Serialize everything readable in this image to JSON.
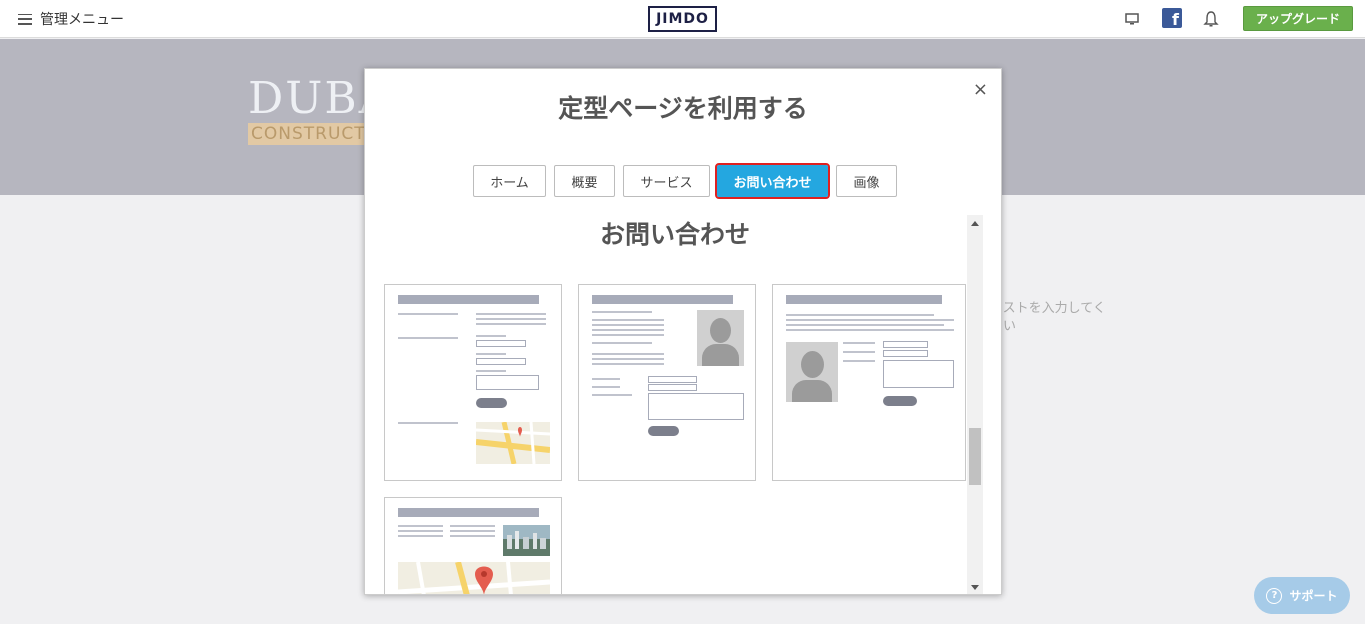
{
  "topbar": {
    "menu_label": "管理メニュー",
    "logo_text": "JIMDO",
    "upgrade_label": "アップグレード",
    "facebook_glyph": "f"
  },
  "background_page": {
    "hero_title": "DUBA",
    "hero_subtitle": "CONSTRUCT",
    "body_text_line1": "キストを入力してく",
    "body_text_line2": "さい"
  },
  "modal": {
    "title": "定型ページを利用する",
    "close_glyph": "×",
    "tabs": [
      {
        "label": "ホーム"
      },
      {
        "label": "概要"
      },
      {
        "label": "サービス"
      },
      {
        "label": "お問い合わせ"
      },
      {
        "label": "画像"
      }
    ],
    "active_tab_index": 3,
    "section_title": "お問い合わせ"
  },
  "support": {
    "label": "サポート",
    "icon_glyph": "?"
  },
  "colors": {
    "accent": "#24a7e0",
    "highlight_border": "#e02020",
    "upgrade_green": "#6ab04c",
    "logo_navy": "#1d2045"
  }
}
